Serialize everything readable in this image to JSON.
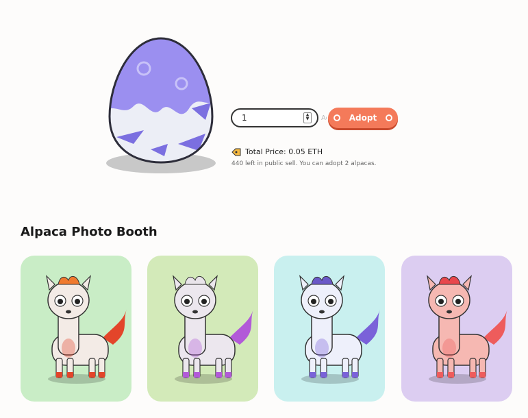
{
  "adopt": {
    "quantity": "1",
    "hidden_hint": "Ad",
    "button_label": "Adopt",
    "price_label": "Total Price: 0.05 ETH",
    "stock_text": "440 left in public sell. You can adopt 2 alpacas."
  },
  "photo_booth": {
    "title": "Alpaca Photo Booth",
    "cards": [
      {
        "bg": "#c9edc6",
        "accent": "#e3452a",
        "hair": "#f07a2e",
        "body": "#f3ebe6"
      },
      {
        "bg": "#d3eab9",
        "accent": "#b25ad8",
        "hair": "#e9e4ea",
        "body": "#ece7ee"
      },
      {
        "bg": "#c9f0ef",
        "accent": "#7a62d9",
        "hair": "#6a58c7",
        "body": "#eef0fb"
      },
      {
        "bg": "#dccdf1",
        "accent": "#ee5c5c",
        "hair": "#e8474c",
        "body": "#f6b8b2"
      }
    ]
  },
  "colors": {
    "accent": "#f47a5a",
    "egg": "#8f84e9"
  },
  "icons": [
    "price-tag-icon",
    "stepper-arrows-icon"
  ]
}
